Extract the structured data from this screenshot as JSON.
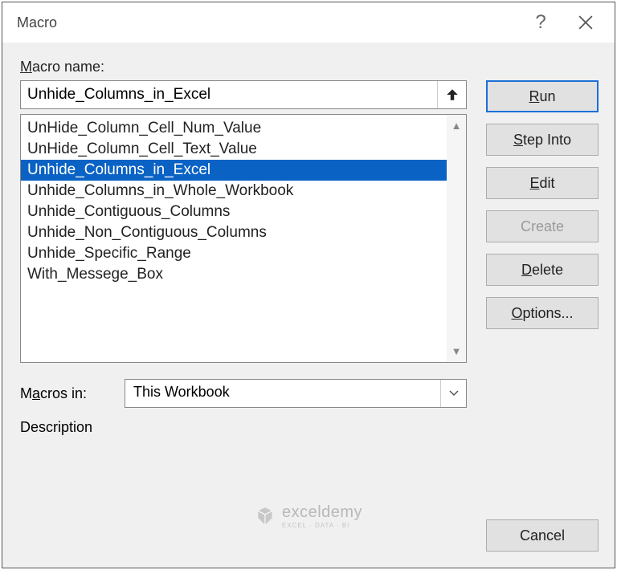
{
  "title": "Macro",
  "labels": {
    "macro_name": "Macro name:",
    "macros_in": "Macros in:",
    "description": "Description"
  },
  "macro_name_value": "Unhide_Columns_in_Excel",
  "macro_list": [
    "UnHide_Column_Cell_Num_Value",
    "UnHide_Column_Cell_Text_Value",
    "Unhide_Columns_in_Excel",
    "Unhide_Columns_in_Whole_Workbook",
    "Unhide_Contiguous_Columns",
    "Unhide_Non_Contiguous_Columns",
    "Unhide_Specific_Range",
    "With_Messege_Box"
  ],
  "selected_index": 2,
  "macros_in_value": "This Workbook",
  "buttons": {
    "run": "Run",
    "step_into": "Step Into",
    "edit": "Edit",
    "create": "Create",
    "delete": "Delete",
    "options": "Options...",
    "cancel": "Cancel"
  },
  "watermark": {
    "name": "exceldemy",
    "sub": "EXCEL · DATA · BI"
  }
}
